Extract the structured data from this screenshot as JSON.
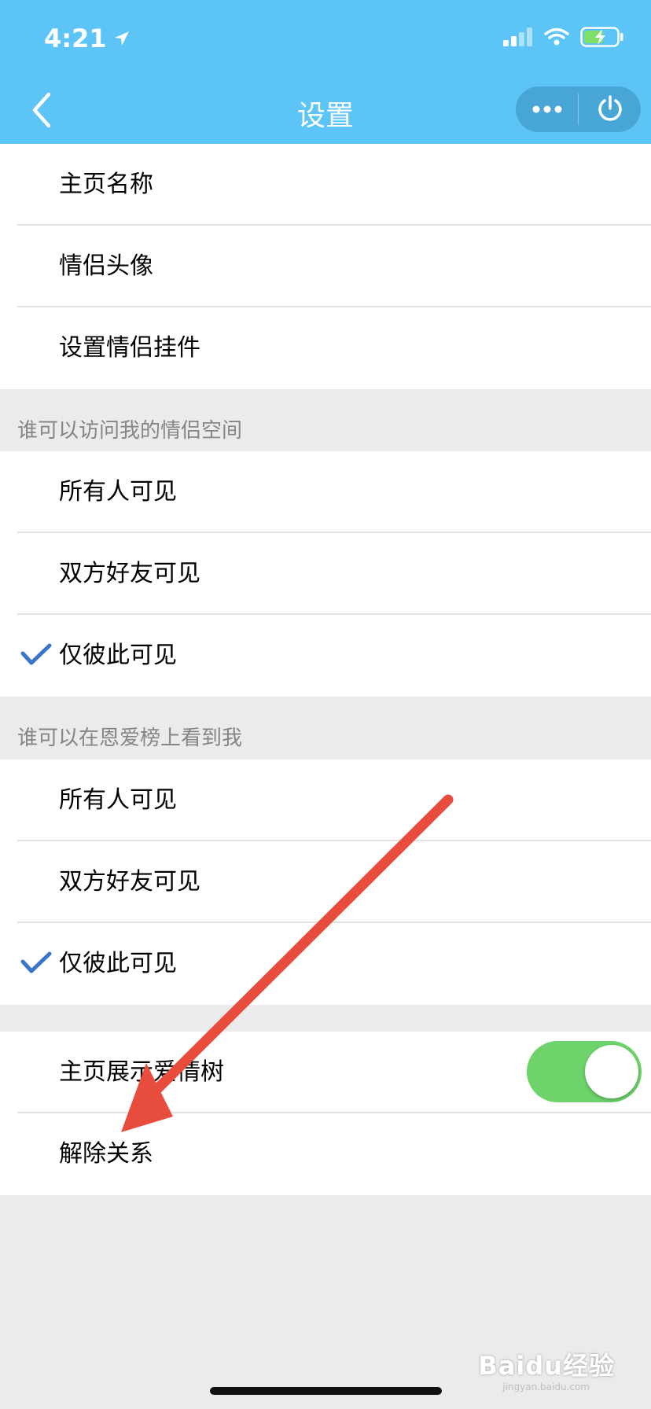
{
  "status_bar": {
    "time": "4:21"
  },
  "nav": {
    "title": "设置"
  },
  "group1": {
    "items": [
      "主页名称",
      "情侣头像",
      "设置情侣挂件"
    ]
  },
  "section_visit": {
    "header": "谁可以访问我的情侣空间",
    "items": [
      "所有人可见",
      "双方好友可见",
      "仅彼此可见"
    ],
    "selected": "仅彼此可见"
  },
  "section_ranking": {
    "header": "谁可以在恩爱榜上看到我",
    "items": [
      "所有人可见",
      "双方好友可见",
      "仅彼此可见"
    ],
    "selected": "仅彼此可见"
  },
  "group4": {
    "show_tree_label": "主页展示爱情树",
    "show_tree_enabled": true,
    "unbind_label": "解除关系"
  },
  "watermark": {
    "brand": "Baidu经验",
    "url": "jingyan.baidu.com"
  },
  "colors": {
    "header": "#5cc4f7",
    "checkmark": "#3b75c9",
    "toggle_on": "#6dd36a",
    "annotation_arrow": "#e84c3d"
  }
}
